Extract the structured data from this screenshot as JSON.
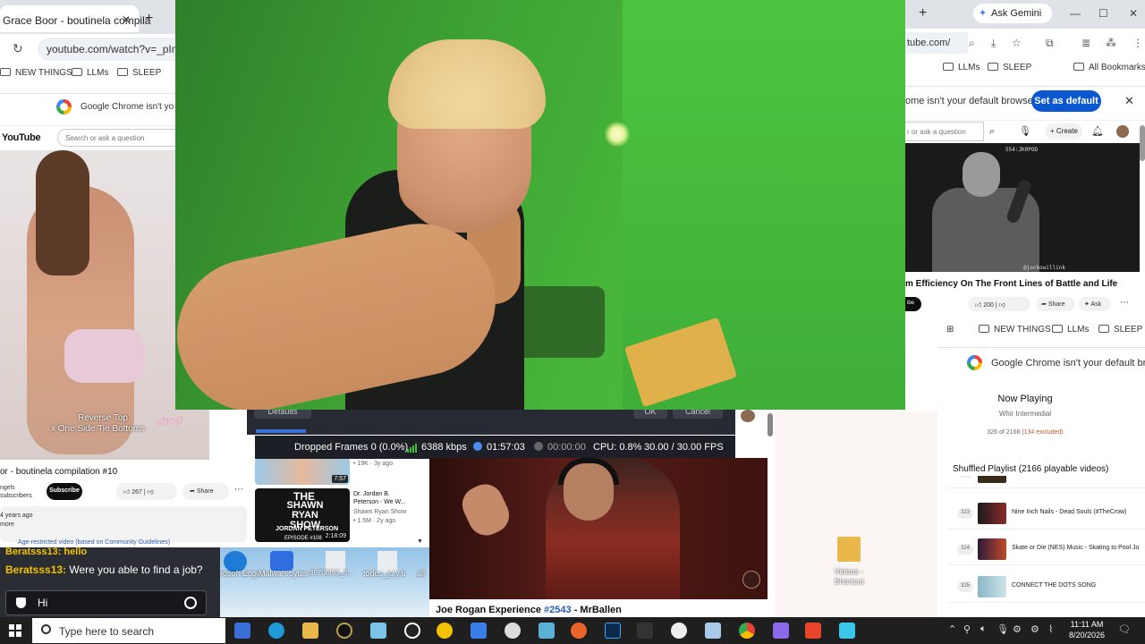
{
  "left_window": {
    "tab_title": "Grace Boor - boutinela compila",
    "tab_close": "✕",
    "new_tab": "+",
    "url": "youtube.com/watch?v=_pIn",
    "bookmarks": [
      "NEW THINGS",
      "LLMs",
      "SLEEP"
    ],
    "default_browser_text": "Google Chrome isn't yo",
    "yt_logo": "YouTube",
    "search_placeholder": "Search or ask a question",
    "video_overlay_line1": "Reverse Top",
    "video_overlay_line2": "x One Side Tie Bottoms",
    "video_overlay_brand": "shop",
    "video_title": "or - boutinela compilation #10",
    "channel_line1": "ngels",
    "channel_line2": "subscribers",
    "subscribe_label": "Subscribe",
    "like_count": "267",
    "share_label": "Share",
    "desc_line1": "4 years ago",
    "desc_line2": "more",
    "restricted_text": "Age-restricted video (based on Community Guidelines)"
  },
  "chat": {
    "prev_line": "Beratsss13: hello",
    "user": "Beratsss13:",
    "message": "Were you able to find a job?",
    "input_value": "Hi"
  },
  "desktop_icons": [
    {
      "label": "rosoft\nEdge"
    },
    {
      "label": "Malwarebytes"
    },
    {
      "label": "3670f833_6..."
    },
    {
      "label": "todos_july.6"
    },
    {
      "label": "all"
    }
  ],
  "obs": {
    "btn_left": "Defaults",
    "btn_ok": "OK",
    "btn_cancel": "Cancel",
    "dropped_frames": "Dropped Frames 0 (0.0%)",
    "bitrate": "6388 kbps",
    "stream_time": "01:57:03",
    "rec_time": "00:00:00",
    "cpu": "CPU: 0.8%",
    "fps": "30.00 / 30.00 FPS"
  },
  "mid_recs": {
    "rec1_meta": "• 19K · 3y ago",
    "rec1_duration": "7:57",
    "rec2_the": "THE",
    "rec2_show_line1": "SHAWN RYAN",
    "rec2_show_line2": "SHOW",
    "rec2_guest": "JORDAN PETERSON",
    "rec2_episode": "EPISODE #108",
    "rec2_duration": "2:18:09",
    "rec2_title_line1": "Dr. Jordan B.",
    "rec2_title_line2": "Peterson - We W...",
    "rec2_channel": "Shawn Ryan Show",
    "rec2_views": "• 1.5M · 2y ago"
  },
  "podcast": {
    "title_prefix": "Joe Rogan Experience ",
    "episode": "#2543",
    "title_suffix": " - MrBallen"
  },
  "right_desktop_icon": {
    "label": "Videos -\nShortcut"
  },
  "right_window": {
    "new_tab": "+",
    "gemini_label": "Ask Gemini",
    "url": "tube.com/",
    "bookmarks": [
      "LLMs",
      "SLEEP",
      "All Bookmarks"
    ],
    "default_browser_text": "ome isn't your default browser",
    "set_default_label": "Set as default",
    "close_label": "✕",
    "search_placeholder": "r or ask a question",
    "create_label": "+ Create",
    "video_top_text": "554:JK0POD",
    "video_bottom_text": "@jockowillink",
    "video_title": "m Efficiency On The Front Lines of Battle and Life",
    "sub_label": "ibe",
    "like_count": "200",
    "share_label": "Share",
    "ask_label": "Ask"
  },
  "right_window2": {
    "bookmarks": [
      "NEW THINGS",
      "LLMs",
      "SLEEP"
    ],
    "default_browser_text": "Google Chrome isn't your default brows",
    "now_playing": "Now Playing",
    "now_playing_sub": "Whir Intermedial",
    "count_prefix": "326 of 2166 ",
    "count_excluded": "(134 excluded)",
    "playlist_header": "Shuffled Playlist (2166 playable videos)",
    "items": [
      {
        "num": "",
        "title": ""
      },
      {
        "num": "323",
        "title": "Nine Inch Nails - Dead Souls (#TheCrow)"
      },
      {
        "num": "324",
        "title": "Skate or Die (NES) Music - Skating to Pool Jo"
      },
      {
        "num": "325",
        "title": "CONNECT THE DOTS SONG"
      }
    ]
  },
  "taskbar": {
    "search_placeholder": "Type here to search",
    "time": "11:11 AM",
    "date": "8/20/2026"
  }
}
